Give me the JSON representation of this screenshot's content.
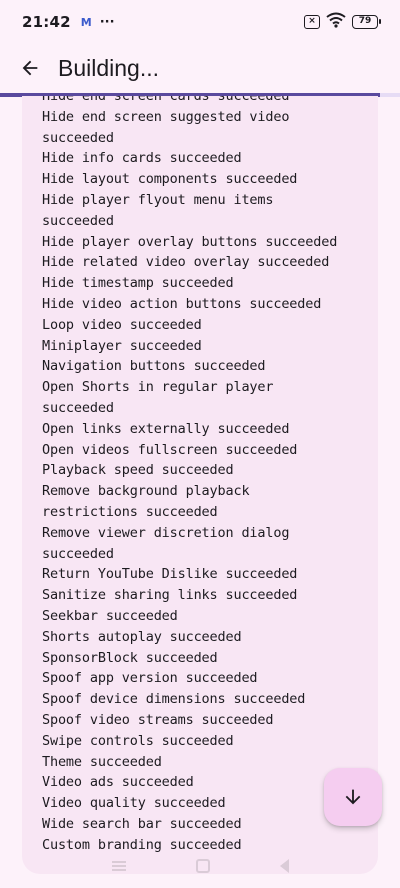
{
  "status_bar": {
    "time": "21:42",
    "mail_glyph": "M",
    "dots": "···",
    "sim_glyph": "×",
    "battery": "79"
  },
  "app_bar": {
    "title": "Building..."
  },
  "progress": {
    "fraction": 0.95
  },
  "log": {
    "lines": [
      "Hide end screen cards succeeded",
      "Hide end screen suggested video",
      "succeeded",
      "Hide info cards succeeded",
      "Hide layout components succeeded",
      "Hide player flyout menu items",
      "succeeded",
      "Hide player overlay buttons succeeded",
      "Hide related video overlay succeeded",
      "Hide timestamp succeeded",
      "Hide video action buttons succeeded",
      "Loop video succeeded",
      "Miniplayer succeeded",
      "Navigation buttons succeeded",
      "Open Shorts in regular player",
      "succeeded",
      "Open links externally succeeded",
      "Open videos fullscreen succeeded",
      "Playback speed succeeded",
      "Remove background playback",
      "restrictions succeeded",
      "Remove viewer discretion dialog",
      "succeeded",
      "Return YouTube Dislike succeeded",
      "Sanitize sharing links succeeded",
      "Seekbar succeeded",
      "Shorts autoplay succeeded",
      "SponsorBlock succeeded",
      "Spoof app version succeeded",
      "Spoof device dimensions succeeded",
      "Spoof video streams succeeded",
      "Swipe controls succeeded",
      "Theme succeeded",
      "Video ads succeeded",
      "Video quality succeeded",
      "Wide search bar succeeded",
      "Custom branding succeeded"
    ]
  },
  "fab": {
    "icon": "arrow-down-icon"
  },
  "colors": {
    "background": "#fdf2fa",
    "card": "#f8e6f4",
    "progress": "#5a4a9e",
    "fab": "#f5cdf0"
  }
}
